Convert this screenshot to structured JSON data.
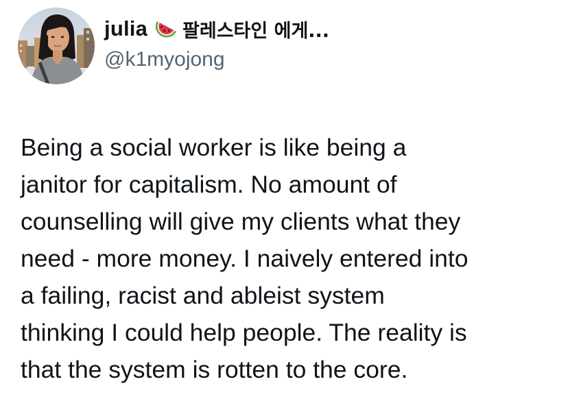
{
  "tweet": {
    "author": {
      "name": "julia",
      "name_emoji_icon": "watermelon-icon",
      "name_suffix": "팔레스타인 에게...",
      "handle": "@k1myojong"
    },
    "text_lines": [
      "Being a social worker is like being a",
      "janitor for capitalism. No amount of",
      "counselling will give my clients what they",
      "need - more money. I naively entered into",
      "a failing, racist and ableist system",
      "thinking I could help people. The reality is",
      "that the system is rotten to the core."
    ]
  },
  "colors": {
    "text_primary": "#0f1419",
    "text_secondary": "#536471",
    "background": "#ffffff"
  }
}
